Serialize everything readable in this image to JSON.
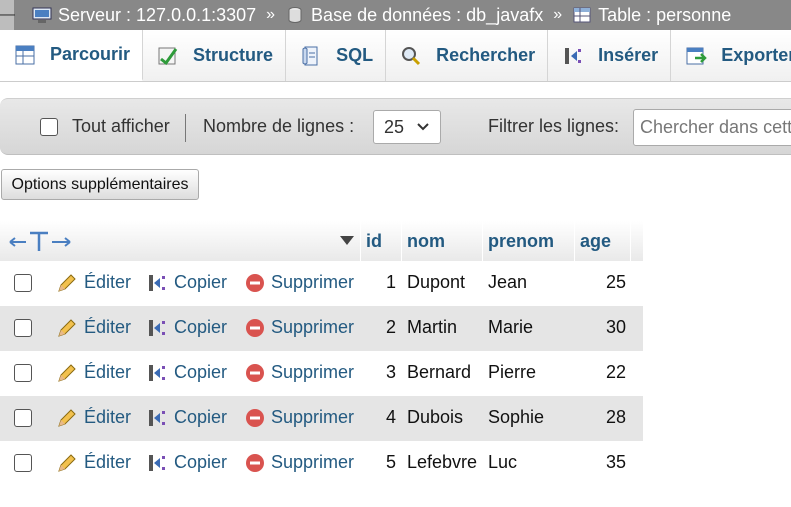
{
  "breadcrumb": {
    "server": "Serveur : 127.0.0.1:3307",
    "database": "Base de données : db_javafx",
    "table": "Table : personne",
    "separator": "»"
  },
  "tabs": [
    {
      "label": "Parcourir",
      "icon": "browse-icon",
      "active": true
    },
    {
      "label": "Structure",
      "icon": "structure-icon",
      "active": false
    },
    {
      "label": "SQL",
      "icon": "sql-icon",
      "active": false
    },
    {
      "label": "Rechercher",
      "icon": "search-icon",
      "active": false
    },
    {
      "label": "Insérer",
      "icon": "insert-icon",
      "active": false
    },
    {
      "label": "Exporter",
      "icon": "export-icon",
      "active": false
    }
  ],
  "navbar": {
    "show_all_label": "Tout afficher",
    "rows_label": "Nombre de lignes :",
    "rows_value": "25",
    "filter_label": "Filtrer les lignes:",
    "filter_placeholder": "Chercher dans cette table"
  },
  "options_button": "Options supplémentaires",
  "table": {
    "columns": [
      "id",
      "nom",
      "prenom",
      "age"
    ],
    "actions": {
      "edit": "Éditer",
      "copy": "Copier",
      "delete": "Supprimer"
    },
    "rows": [
      {
        "id": "1",
        "nom": "Dupont",
        "prenom": "Jean",
        "age": "25"
      },
      {
        "id": "2",
        "nom": "Martin",
        "prenom": "Marie",
        "age": "30"
      },
      {
        "id": "3",
        "nom": "Bernard",
        "prenom": "Pierre",
        "age": "22"
      },
      {
        "id": "4",
        "nom": "Dubois",
        "prenom": "Sophie",
        "age": "28"
      },
      {
        "id": "5",
        "nom": "Lefebvre",
        "prenom": "Luc",
        "age": "35"
      }
    ]
  },
  "colors": {
    "link": "#235a81",
    "breadcrumb_bg": "#888888",
    "row_alt": "#e5e5e5",
    "delete": "#d9534f"
  }
}
